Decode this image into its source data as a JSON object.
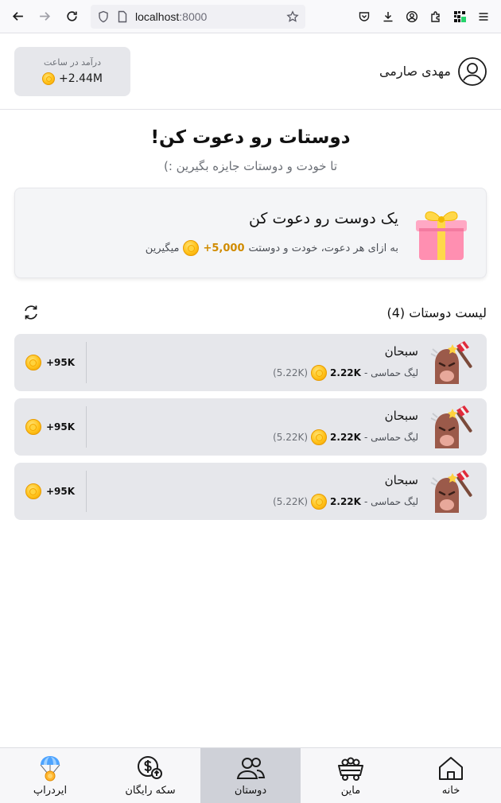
{
  "browser": {
    "url_host": "localhost",
    "url_port": ":8000"
  },
  "header": {
    "income_label": "درآمد در ساعت",
    "income_value": "+2.44M",
    "user_name": "مهدی صارمی"
  },
  "main": {
    "title": "دوستات رو دعوت کن!",
    "subtitle": "تا خودت و دوستات جایزه بگیرین :)",
    "invite": {
      "title": "یک دوست رو دعوت کن",
      "desc_prefix": "به ازای هر دعوت، خودت و دوستت",
      "bonus": "+5,000",
      "desc_suffix": "میگیرین"
    },
    "friends_title": "لیست دوستات (4)",
    "friends": [
      {
        "name": "سبحان",
        "league": "لیگ حماسی -",
        "amount": "2.22K",
        "sub": "(5.22K)",
        "reward": "+95K"
      },
      {
        "name": "سبحان",
        "league": "لیگ حماسی -",
        "amount": "2.22K",
        "sub": "(5.22K)",
        "reward": "+95K"
      },
      {
        "name": "سبحان",
        "league": "لیگ حماسی -",
        "amount": "2.22K",
        "sub": "(5.22K)",
        "reward": "+95K"
      }
    ]
  },
  "bottom_nav": {
    "home": "خانه",
    "mine": "ماین",
    "friends": "دوستان",
    "free_coin": "سکه رایگان",
    "airdrop": "ایردراپ"
  }
}
